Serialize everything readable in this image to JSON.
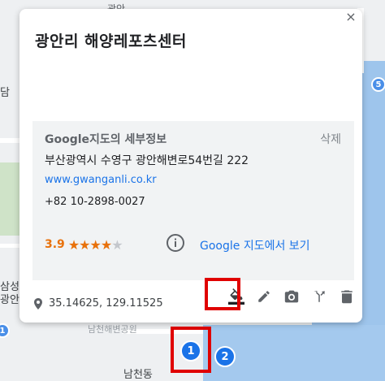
{
  "map": {
    "labels": {
      "top_center": "광안",
      "left_mid": "담",
      "left_lower1": "삼성",
      "left_lower2": "광안",
      "beach_park": "남천해변공원",
      "bottom": "남천동"
    },
    "markers": [
      {
        "number": "1",
        "selected": true
      },
      {
        "number": "2",
        "selected": false
      },
      {
        "number": "5"
      },
      {
        "number": "1"
      }
    ]
  },
  "card": {
    "close_glyph": "×",
    "title": "광안리 해양레포츠센터",
    "details": {
      "heading": "Google지도의 세부정보",
      "delete_label": "삭제",
      "address": "부산광역시 수영구 광안해변로54번길 222",
      "website": "www.gwanganli.co.kr",
      "phone": "+82 10-2898-0027",
      "rating": "3.9",
      "stars_filled": "★★★★",
      "stars_empty": "★",
      "maps_link": "Google 지도에서 보기"
    },
    "coordinates": "35.14625, 129.11525"
  },
  "colors": {
    "accent": "#1a73e8",
    "rating": "#e8710a",
    "highlight": "#e00000"
  },
  "icons": [
    "close-icon",
    "info-icon",
    "location-pin-icon",
    "paint-bucket-icon",
    "edit-pencil-icon",
    "camera-icon",
    "directions-icon",
    "trash-icon"
  ]
}
